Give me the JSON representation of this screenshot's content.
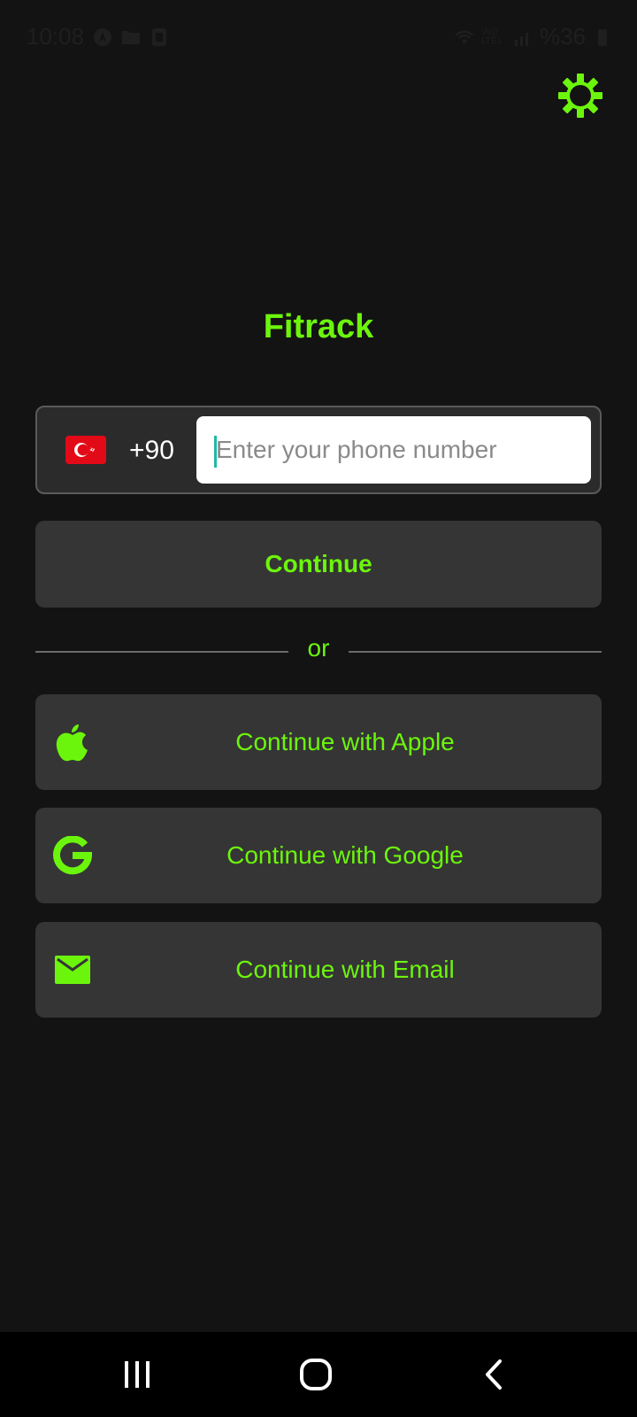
{
  "status_bar": {
    "time": "10:08",
    "network_label": "Vo)) LTE1",
    "battery": "%36"
  },
  "app": {
    "title": "Fitrack",
    "accent_color": "#6cf50c",
    "background_color": "#131313"
  },
  "phone": {
    "country_flag": "turkey-flag",
    "dial_code": "+90",
    "placeholder": "Enter your phone number",
    "value": ""
  },
  "continue_label": "Continue",
  "divider_text": "or",
  "social": {
    "apple_label": "Continue with Apple",
    "google_label": "Continue with Google",
    "email_label": "Continue with Email"
  },
  "icons": {
    "settings": "gear-icon",
    "apple": "apple-icon",
    "google": "google-icon",
    "email": "mail-icon"
  },
  "nav": {
    "recents": "recents-icon",
    "home": "home-icon",
    "back": "back-icon"
  }
}
